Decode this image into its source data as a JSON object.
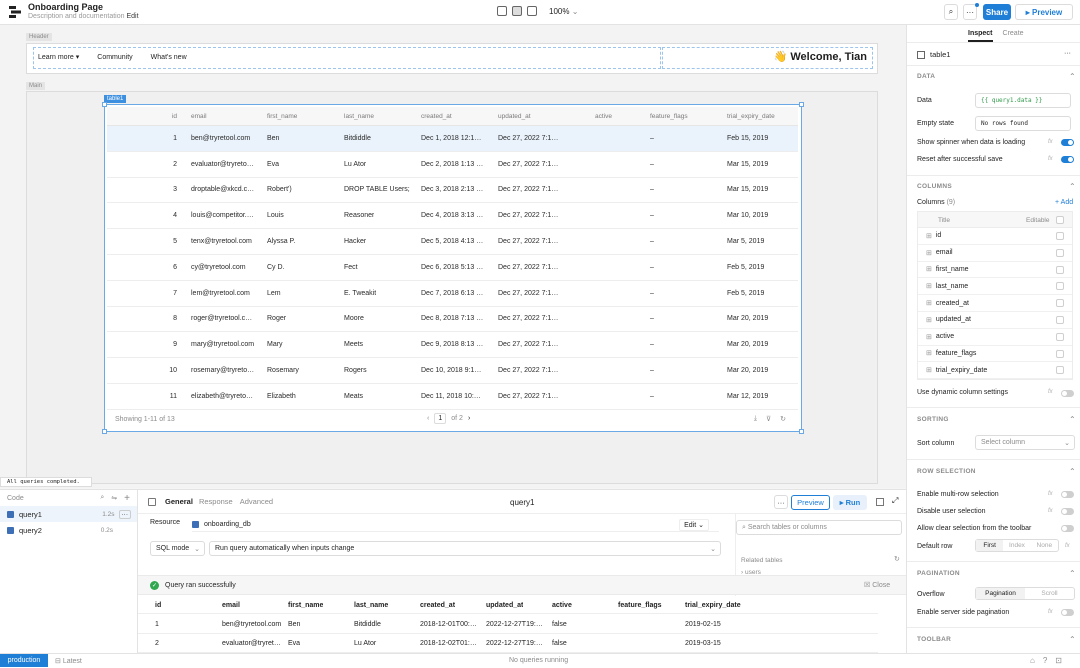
{
  "app": {
    "title": "Onboarding Page",
    "subtitle": "Description and documentation",
    "edit_link": "Edit",
    "zoom": "100%"
  },
  "toolbar": {
    "more": "···",
    "share": "Share",
    "preview": "▸ Preview"
  },
  "canvas": {
    "header_label": "Header",
    "main_label": "Main",
    "nav": [
      {
        "label": "Learn more ▾"
      },
      {
        "label": "Community"
      },
      {
        "label": "What's new"
      }
    ],
    "welcome": "👋 Welcome, Tian",
    "table_tag": "table1"
  },
  "table": {
    "columns": [
      "id",
      "email",
      "first_name",
      "last_name",
      "created_at",
      "updated_at",
      "active",
      "feature_flags",
      "trial_expiry_date"
    ],
    "rows": [
      [
        "1",
        "ben@tryretool.com",
        "Ben",
        "Bitdiddle",
        "Dec 1, 2018 12:1…",
        "Dec 27, 2022 7:1…",
        "",
        "–",
        "Feb 15, 2019"
      ],
      [
        "2",
        "evaluator@tryreto…",
        "Eva",
        "Lu Ator",
        "Dec 2, 2018 1:13 …",
        "Dec 27, 2022 7:1…",
        "",
        "–",
        "Mar 15, 2019"
      ],
      [
        "3",
        "droptable@xkcd.c…",
        "Robert')",
        "DROP TABLE Users;",
        "Dec 3, 2018 2:13 …",
        "Dec 27, 2022 7:1…",
        "",
        "–",
        "Mar 15, 2019"
      ],
      [
        "4",
        "louis@competitor.…",
        "Louis",
        "Reasoner",
        "Dec 4, 2018 3:13 …",
        "Dec 27, 2022 7:1…",
        "",
        "–",
        "Mar 10, 2019"
      ],
      [
        "5",
        "tenx@tryretool.com",
        "Alyssa P.",
        "Hacker",
        "Dec 5, 2018 4:13 …",
        "Dec 27, 2022 7:1…",
        "",
        "–",
        "Mar 5, 2019"
      ],
      [
        "6",
        "cy@tryretool.com",
        "Cy D.",
        "Fect",
        "Dec 6, 2018 5:13 …",
        "Dec 27, 2022 7:1…",
        "",
        "–",
        "Feb 5, 2019"
      ],
      [
        "7",
        "lem@tryretool.com",
        "Lem",
        "E. Tweakit",
        "Dec 7, 2018 6:13 …",
        "Dec 27, 2022 7:1…",
        "",
        "–",
        "Feb 5, 2019"
      ],
      [
        "8",
        "roger@tryretool.c…",
        "Roger",
        "Moore",
        "Dec 8, 2018 7:13 …",
        "Dec 27, 2022 7:1…",
        "",
        "–",
        "Mar 20, 2019"
      ],
      [
        "9",
        "mary@tryretool.com",
        "Mary",
        "Meets",
        "Dec 9, 2018 8:13 …",
        "Dec 27, 2022 7:1…",
        "",
        "–",
        "Mar 20, 2019"
      ],
      [
        "10",
        "rosemary@tryreto…",
        "Rosemary",
        "Rogers",
        "Dec 10, 2018 9:1…",
        "Dec 27, 2022 7:1…",
        "",
        "–",
        "Mar 20, 2019"
      ],
      [
        "11",
        "elizabeth@tryreto…",
        "Elizabeth",
        "Meats",
        "Dec 11, 2018 10:…",
        "Dec 27, 2022 7:1…",
        "",
        "–",
        "Mar 12, 2019"
      ]
    ],
    "footer": {
      "showing": "Showing 1-11 of 13",
      "page": "1",
      "of": "of 2"
    }
  },
  "status_toast": "All queries completed.",
  "query_list": {
    "title": "Code",
    "items": [
      {
        "name": "query1",
        "time": "1.2s"
      },
      {
        "name": "query2",
        "time": "0.2s"
      }
    ]
  },
  "query_editor": {
    "tabs": [
      "General",
      "Response",
      "Advanced"
    ],
    "name": "query1",
    "preview": "Preview",
    "run": "▸ Run",
    "resource_label": "Resource",
    "resource_value": "onboarding_db",
    "edit": "Edit",
    "mode": "SQL mode",
    "trigger": "Run query automatically when inputs change",
    "search_placeholder": "Search tables or columns",
    "related_tables": "Related tables",
    "users": "users",
    "success": "Query ran successfully",
    "close": "Close",
    "result_columns": [
      "id",
      "email",
      "first_name",
      "last_name",
      "created_at",
      "updated_at",
      "active",
      "feature_flags",
      "trial_expiry_date"
    ],
    "result_rows": [
      [
        "1",
        "ben@tryretool.com",
        "Ben",
        "Bitdiddle",
        "2018-12-01T00:…",
        "2022-12-27T19:…",
        "false",
        "",
        "2019-02-15"
      ],
      [
        "2",
        "evaluator@tryret…",
        "Eva",
        "Lu Ator",
        "2018-12-02T01:…",
        "2022-12-27T19:…",
        "false",
        "",
        "2019-03-15"
      ]
    ]
  },
  "statusbar": {
    "env": "production",
    "branch": "Latest",
    "center": "No queries running"
  },
  "inspector": {
    "tabs": [
      "Inspect",
      "Create"
    ],
    "component": "table1",
    "data_section": "DATA",
    "data_label": "Data",
    "data_value": "{{ query1.data }}",
    "empty_label": "Empty state",
    "empty_value": "No rows found",
    "spinner_label": "Show spinner when data is loading",
    "reset_label": "Reset after successful save",
    "columns_section": "COLUMNS",
    "columns_label": "Columns",
    "columns_count": "(9)",
    "add": "+ Add",
    "title_head": "Title",
    "editable_head": "Editable",
    "columns": [
      "id",
      "email",
      "first_name",
      "last_name",
      "created_at",
      "updated_at",
      "active",
      "feature_flags",
      "trial_expiry_date"
    ],
    "dynamic_cols": "Use dynamic column settings",
    "sorting_section": "SORTING",
    "sort_label": "Sort column",
    "sort_placeholder": "Select column",
    "row_sel_section": "ROW SELECTION",
    "multi_row": "Enable multi-row selection",
    "disable_sel": "Disable user selection",
    "allow_clear": "Allow clear selection from the toolbar",
    "default_row": "Default row",
    "default_opts": [
      "First",
      "Index",
      "None"
    ],
    "pagination_section": "PAGINATION",
    "overflow": "Overflow",
    "overflow_opts": [
      "Pagination",
      "Scroll"
    ],
    "server_side": "Enable server side pagination",
    "toolbar_section": "TOOLBAR"
  },
  "colors": {
    "accent": "#1f7fd6"
  }
}
